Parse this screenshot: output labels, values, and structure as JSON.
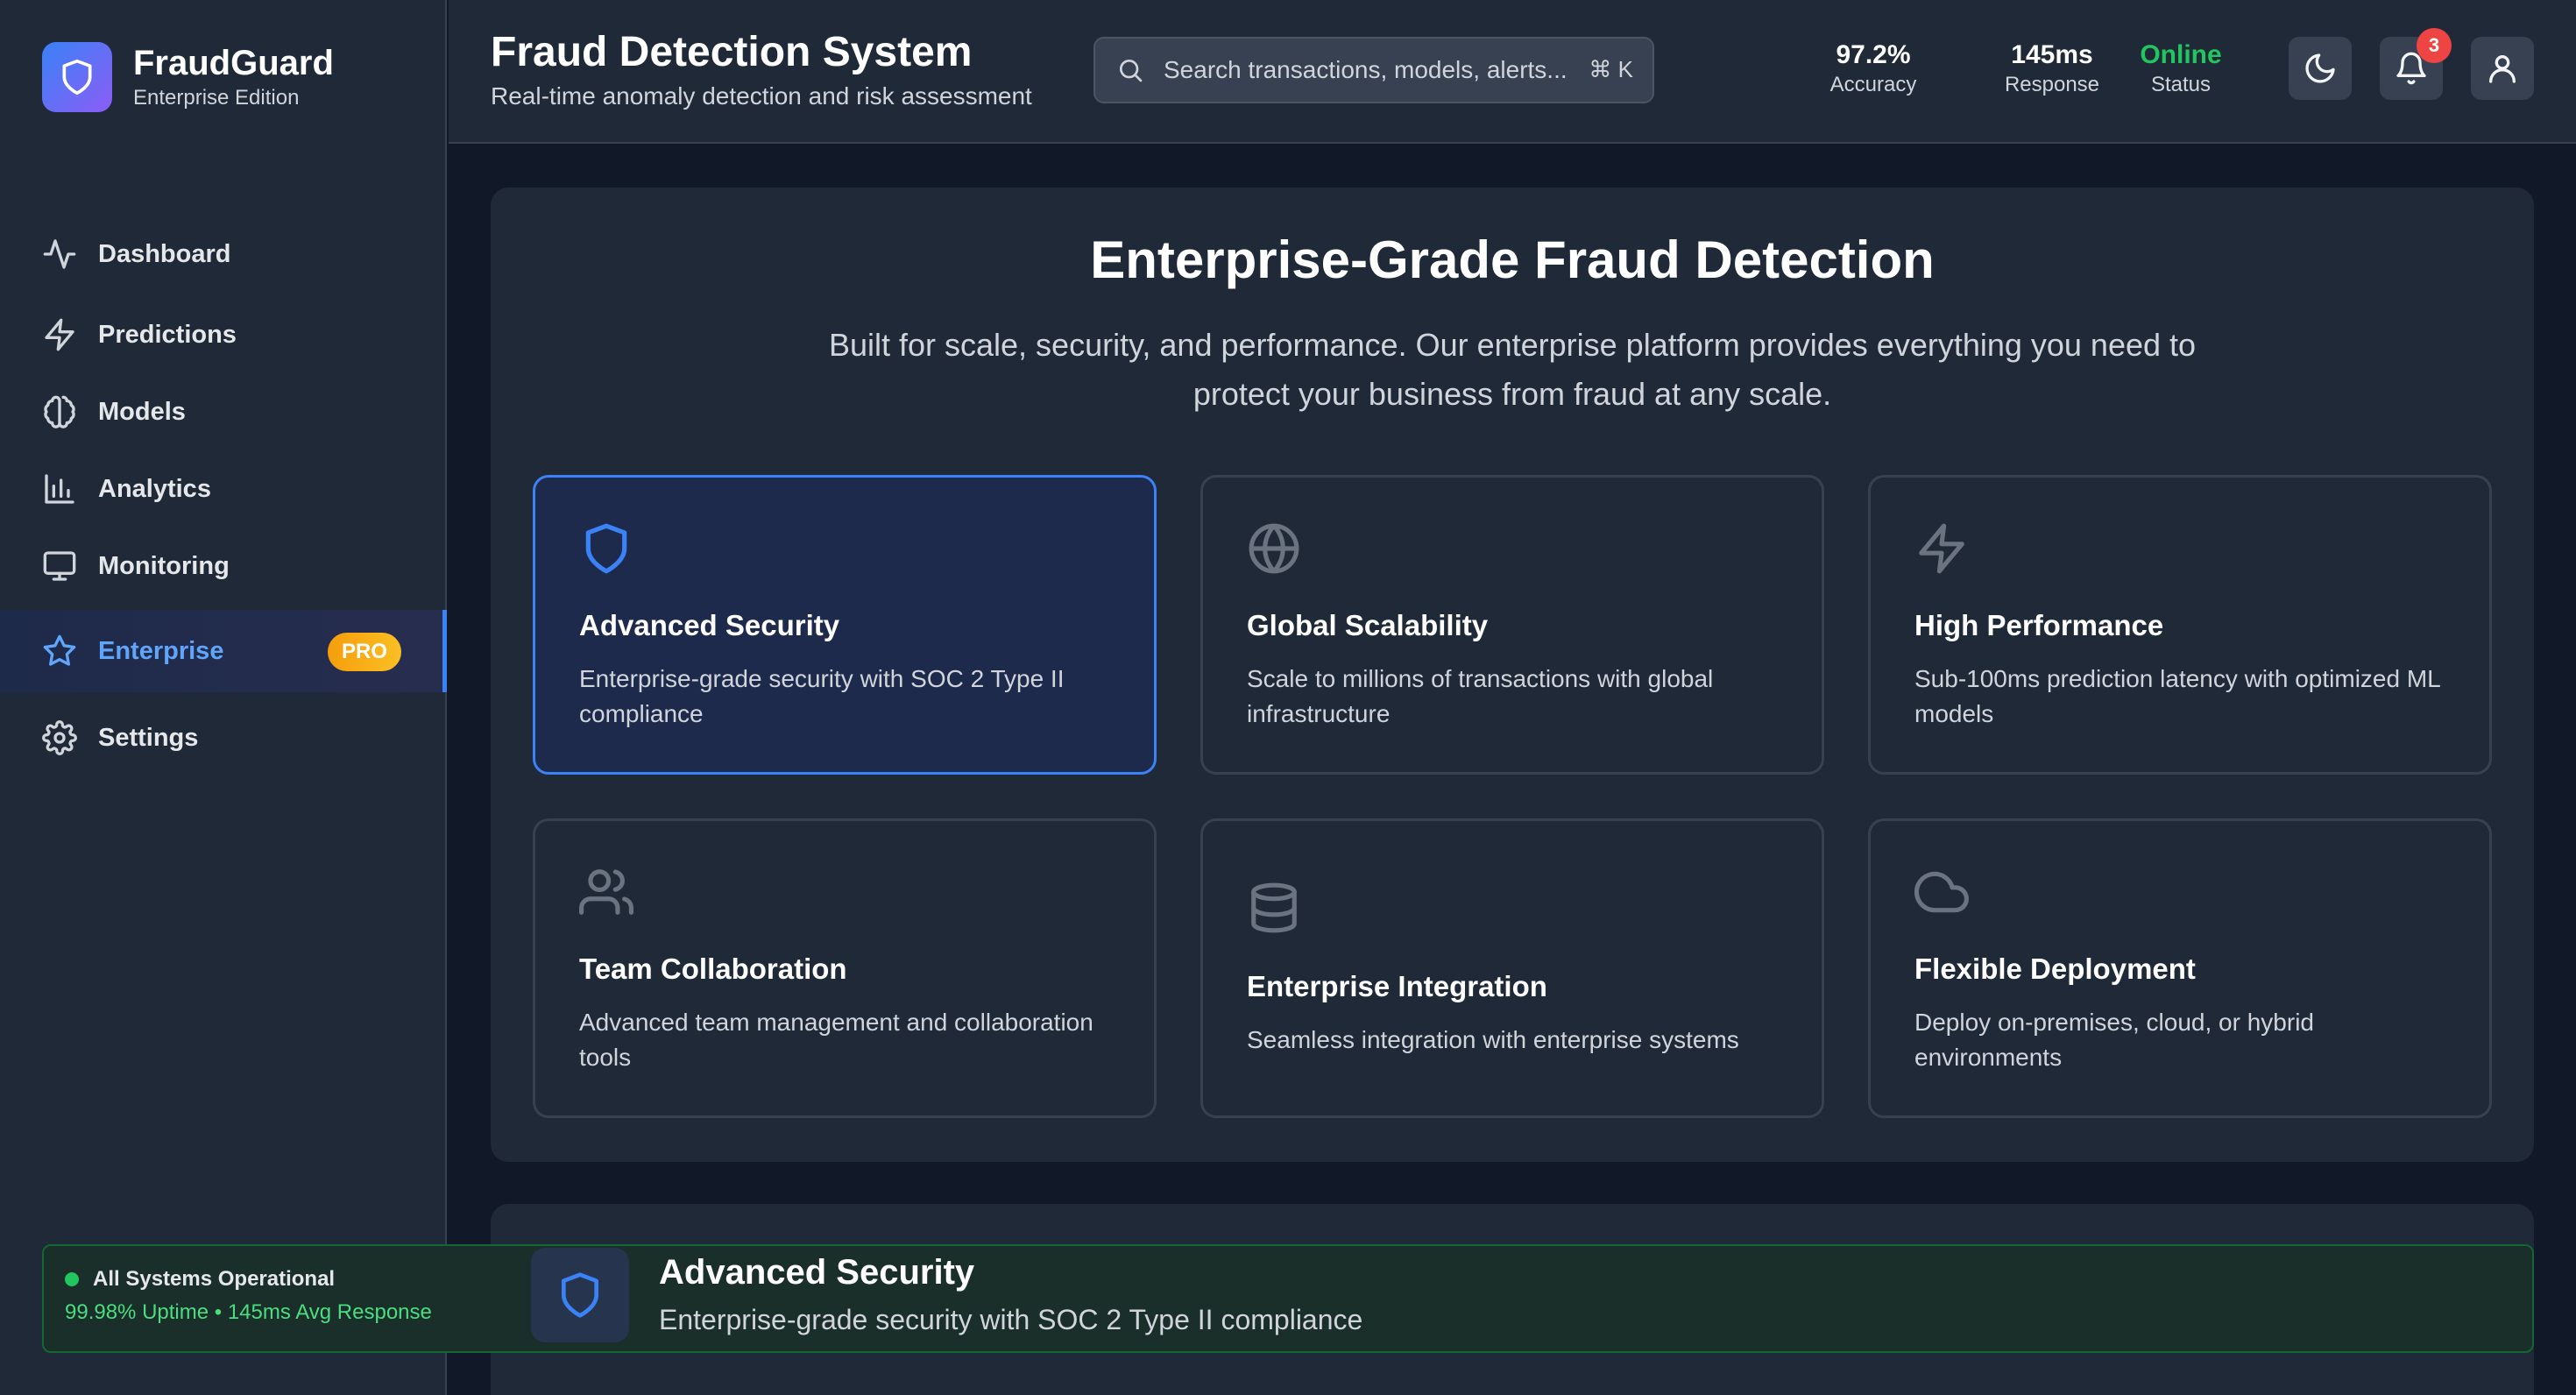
{
  "brand": {
    "name": "FraudGuard",
    "edition": "Enterprise Edition"
  },
  "sidebar": {
    "items": [
      {
        "label": "Dashboard",
        "icon": "activity-icon"
      },
      {
        "label": "Predictions",
        "icon": "zap-icon"
      },
      {
        "label": "Models",
        "icon": "brain-icon"
      },
      {
        "label": "Analytics",
        "icon": "bar-chart-icon"
      },
      {
        "label": "Monitoring",
        "icon": "monitor-icon"
      },
      {
        "label": "Enterprise",
        "icon": "star-icon",
        "badge": "PRO",
        "active": true
      },
      {
        "label": "Settings",
        "icon": "gear-icon"
      }
    ]
  },
  "status": {
    "title": "All Systems Operational",
    "detail": "99.98% Uptime • 145ms Avg Response"
  },
  "header": {
    "title": "Fraud Detection System",
    "subtitle": "Real-time anomaly detection and risk assessment",
    "search_placeholder": "Search transactions, models, alerts...",
    "search_shortcut": "⌘ K",
    "metrics": [
      {
        "value": "97.2%",
        "label": "Accuracy"
      },
      {
        "value": "145ms",
        "label": "Response"
      },
      {
        "value": "Online",
        "label": "Status"
      }
    ],
    "notification_count": "3"
  },
  "enterprise": {
    "title": "Enterprise-Grade Fraud Detection",
    "subtitle": "Built for scale, security, and performance. Our enterprise platform provides everything you need to protect your business from fraud at any scale.",
    "features": [
      {
        "title": "Advanced Security",
        "description": "Enterprise-grade security with SOC 2 Type II compliance",
        "icon": "shield-icon",
        "selected": true
      },
      {
        "title": "Global Scalability",
        "description": "Scale to millions of transactions with global infrastructure",
        "icon": "globe-icon"
      },
      {
        "title": "High Performance",
        "description": "Sub-100ms prediction latency with optimized ML models",
        "icon": "zap-icon"
      },
      {
        "title": "Team Collaboration",
        "description": "Advanced team management and collaboration tools",
        "icon": "users-icon"
      },
      {
        "title": "Enterprise Integration",
        "description": "Seamless integration with enterprise systems",
        "icon": "database-icon"
      },
      {
        "title": "Flexible Deployment",
        "description": "Deploy on-premises, cloud, or hybrid environments",
        "icon": "cloud-icon"
      }
    ]
  },
  "detail": {
    "title": "Advanced Security",
    "subtitle": "Enterprise-grade security with SOC 2 Type II compliance"
  },
  "colors": {
    "accent": "#3b82f6",
    "success": "#22c55e",
    "badge": "#f59e0b",
    "danger": "#ef4444",
    "background": "#111827",
    "surface": "#1f2937"
  }
}
